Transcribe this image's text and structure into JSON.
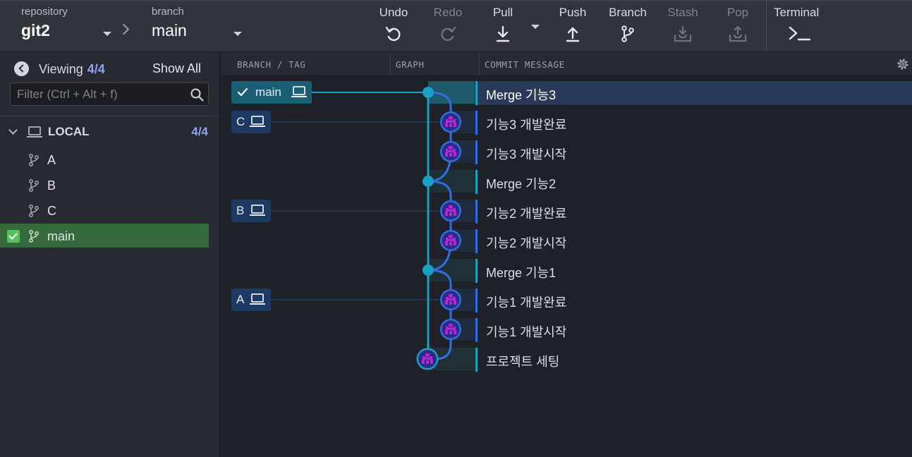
{
  "toolbar": {
    "repository_label": "repository",
    "repository_value": "git2",
    "branch_label": "branch",
    "branch_value": "main",
    "actions": {
      "undo": "Undo",
      "redo": "Redo",
      "pull": "Pull",
      "push": "Push",
      "branch": "Branch",
      "stash": "Stash",
      "pop": "Pop",
      "terminal": "Terminal"
    }
  },
  "sidebar": {
    "viewing_label": "Viewing",
    "viewing_count": "4/4",
    "show_all": "Show All",
    "filter_placeholder": "Filter (Ctrl + Alt + f)",
    "local": {
      "label": "LOCAL",
      "count": "4/4"
    },
    "branches": [
      {
        "name": "A"
      },
      {
        "name": "B"
      },
      {
        "name": "C"
      },
      {
        "name": "main",
        "checked_out": true
      }
    ]
  },
  "graph": {
    "columns": {
      "branch_tag": "BRANCH / TAG",
      "graph": "GRAPH",
      "commit_message": "COMMIT MESSAGE"
    },
    "refs": {
      "main": "main",
      "c": "C",
      "b": "B",
      "a": "A"
    },
    "commits": [
      {
        "message": "Merge 기능3",
        "selected": true
      },
      {
        "message": "기능3 개발완료"
      },
      {
        "message": "기능3 개발시작"
      },
      {
        "message": "Merge 기능2"
      },
      {
        "message": "기능2 개발완료"
      },
      {
        "message": "기능2 개발시작"
      },
      {
        "message": "Merge 기능1"
      },
      {
        "message": "기능1 개발완료"
      },
      {
        "message": "기능1 개발시작"
      },
      {
        "message": "프로젝트 세팅"
      }
    ],
    "colors": {
      "main_lane": "#1aa0c4",
      "branch_lane": "#2f6fe0",
      "avatar": "#c21fd2"
    }
  }
}
